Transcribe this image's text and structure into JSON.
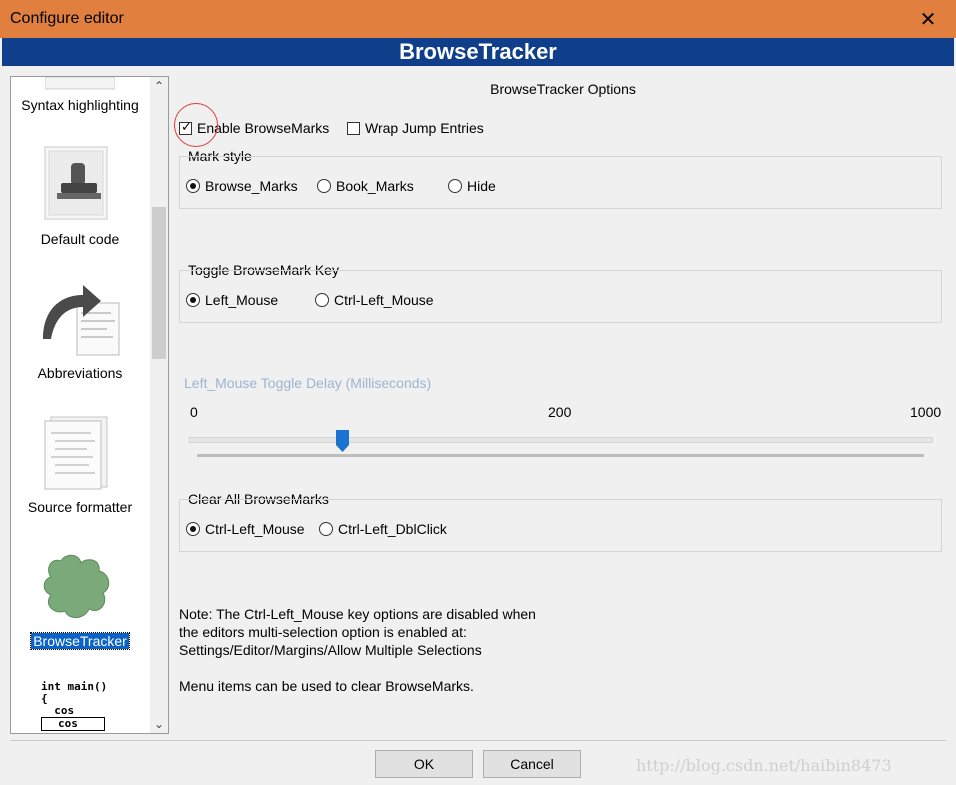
{
  "window": {
    "title": "Configure editor",
    "close_glyph": "✕"
  },
  "banner": {
    "title": "BrowseTracker"
  },
  "sidebar": {
    "items": [
      {
        "label": "Syntax highlighting",
        "icon": "syntax-highlighting-icon",
        "selected": false
      },
      {
        "label": "Default code",
        "icon": "stamp-document-icon",
        "selected": false
      },
      {
        "label": "Abbreviations",
        "icon": "curved-arrow-document-icon",
        "selected": false
      },
      {
        "label": "Source formatter",
        "icon": "formatted-document-icon",
        "selected": false
      },
      {
        "label": "BrowseTracker",
        "icon": "puzzle-piece-icon",
        "selected": true
      },
      {
        "label": "",
        "icon": "code-completion-icon",
        "selected": false
      }
    ],
    "code_icon_lines": [
      "int main()",
      "{",
      "  cos",
      "cos"
    ]
  },
  "panel": {
    "heading": "BrowseTracker Options",
    "enable_browsemarks": {
      "label": "Enable BrowseMarks",
      "checked": true
    },
    "wrap_jump_entries": {
      "label": "Wrap Jump Entries",
      "checked": false
    },
    "mark_style": {
      "label": "Mark style",
      "options": [
        "Browse_Marks",
        "Book_Marks",
        "Hide"
      ],
      "selected": "Browse_Marks"
    },
    "toggle_key": {
      "label": "Toggle BrowseMark Key",
      "options": [
        "Left_Mouse",
        "Ctrl-Left_Mouse"
      ],
      "selected": "Left_Mouse"
    },
    "toggle_delay": {
      "label": "Left_Mouse Toggle Delay (Milliseconds)",
      "tick_labels": [
        "0",
        "200",
        "1000"
      ],
      "value": 200
    },
    "clear_all": {
      "label": "Clear All BrowseMarks",
      "options": [
        "Ctrl-Left_Mouse",
        "Ctrl-Left_DblClick"
      ],
      "selected": "Ctrl-Left_Mouse"
    },
    "note_lines": [
      "Note: The Ctrl-Left_Mouse key options are disabled when",
      "the editors multi-selection option is enabled at:",
      "Settings/Editor/Margins/Allow Multiple Selections"
    ],
    "menu_note": "Menu items can be used to clear BrowseMarks."
  },
  "buttons": {
    "ok": "OK",
    "cancel": "Cancel"
  },
  "watermark": "http://blog.csdn.net/haibin8473",
  "colors": {
    "titlebar": "#e07f3e",
    "banner": "#0f3f8a",
    "selection": "#0b63c8",
    "slider_thumb": "#1a73d0",
    "annotation": "#e23a3a"
  }
}
